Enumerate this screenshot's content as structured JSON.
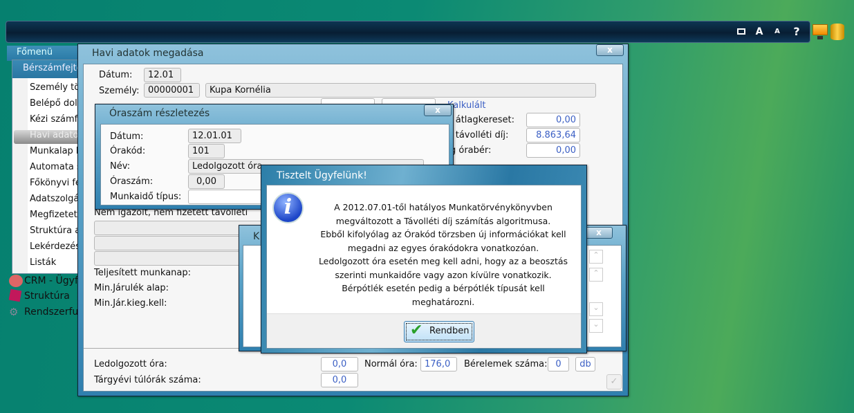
{
  "topbar": {
    "icons": [
      "window-icon",
      "font-large-icon",
      "font-small-icon",
      "help-icon"
    ],
    "labels": [
      "A",
      "A",
      "?"
    ]
  },
  "sidebar": {
    "tab": "Főmenü",
    "submenu_title": "Bérszámfejtés",
    "items": [
      "Személy tör",
      "Belépő dolg",
      "Kézi számfe",
      "Havi adatok",
      "Munkalap b",
      "Automata s",
      "Főkönyvi fe",
      "Adatszolgál",
      "Megfizetett",
      "Struktúra a",
      "Lekérdezés",
      "Listák"
    ],
    "selected_index": 3,
    "modules": [
      "CRM - Ügyfé",
      "Struktúra",
      "Rendszerfunk"
    ]
  },
  "havi": {
    "title": "Havi adatok megadása",
    "close": "x",
    "datum_label": "Dátum:",
    "datum": "12.01",
    "szemely_label": "Személy:",
    "szemely_id": "00000001",
    "szemely_name": "Kupa Kornélia",
    "kalkulalt": "Kalkulált",
    "right_labels": [
      "i átlagkereset:",
      "i távolléti díj:",
      "g órabér:"
    ],
    "right_values": [
      "0,00",
      "8.863,64",
      "0,00"
    ],
    "nem_igazolt": "Nem igazolt, nem fizetett távolléti",
    "teljesitett": "Teljesített munkanap:",
    "min_jarulek": "Min.Járulék alap:",
    "min_jar_kieg": "Min.Jár.kieg.kell:",
    "ledolgozott_label": "Ledolgozott óra:",
    "ledolgozott": "0,0",
    "normal_label": "Normál óra:",
    "normal": "176,0",
    "berelemek_label": "Bérelemek száma:",
    "berelemek": "0",
    "db": "db",
    "targyevi_label": "Tárgyévi túlórák száma:",
    "targyevi": "0,0"
  },
  "oraszam": {
    "title": "Óraszám részletezés",
    "close": "x",
    "labels": [
      "Dátum:",
      "Órakód:",
      "Név:",
      "Óraszám:",
      "Munkaidő típus:"
    ],
    "datum": "12.01.01",
    "orakod": "101",
    "nev": "Ledolgozott óra",
    "oraszam": "0,00",
    "munkaido": ""
  },
  "k_window": {
    "title": "K",
    "close": "x"
  },
  "dialog": {
    "title": "Tisztelt Ügyfelünk!",
    "lines": [
      "A 2012.07.01-től hatályos Munkatörvénykönyvben",
      "megváltozott a Távolléti díj számítás algoritmusa.",
      "Ebből kifolyólag az Órakód törzsben új információkat kell",
      "megadni az egyes órakódokra vonatkozóan.",
      "Ledolgozott óra esetén meg kell adni, hogy az a beosztás",
      "szerinti munkaidőre vagy azon kívülre vonatkozik.",
      "Bérpótlék esetén pedig a bérpótlék típusát kell",
      "meghatározni."
    ],
    "ok": "Rendben",
    "icon_letter": "i"
  }
}
